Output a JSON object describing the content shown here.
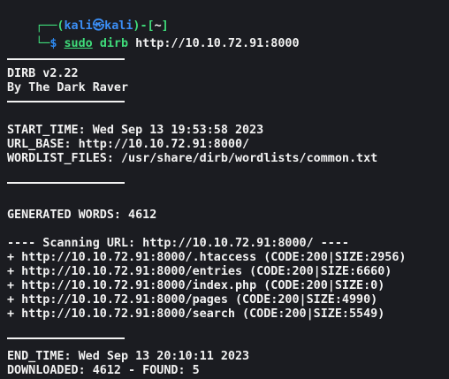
{
  "prompt": {
    "box_top": "┌──(",
    "user": "kali",
    "at": "㉿",
    "host": "kali",
    "bracket_close": ")-[",
    "cwd": "~",
    "cwd_close": "]",
    "box_bottom": "└─",
    "symbol": "$"
  },
  "command": {
    "sudo": "sudo",
    "binary": "dirb",
    "argument": "http://10.10.72.91:8000"
  },
  "banner": {
    "version": "DIRB v2.22",
    "author": "By The Dark Raver"
  },
  "info": {
    "start_time": "START_TIME: Wed Sep 13 19:53:58 2023",
    "url_base": "URL_BASE: http://10.10.72.91:8000/",
    "wordlist": "WORDLIST_FILES: /usr/share/dirb/wordlists/common.txt"
  },
  "generated": "GENERATED WORDS: 4612",
  "scan_header": "---- Scanning URL: http://10.10.72.91:8000/ ----",
  "results": [
    "+ http://10.10.72.91:8000/.htaccess (CODE:200|SIZE:2956)",
    "+ http://10.10.72.91:8000/entries (CODE:200|SIZE:6660)",
    "+ http://10.10.72.91:8000/index.php (CODE:200|SIZE:0)",
    "+ http://10.10.72.91:8000/pages (CODE:200|SIZE:4990)",
    "+ http://10.10.72.91:8000/search (CODE:200|SIZE:5549)"
  ],
  "summary": {
    "end_time": "END_TIME: Wed Sep 13 20:10:11 2023",
    "downloaded": "DOWNLOADED: 4612 - FOUND: 5"
  },
  "colors": {
    "background": "#1b1c21",
    "prompt_blue": "#2d88f0",
    "prompt_green": "#3fdc7a",
    "text": "#f2f2f2"
  }
}
